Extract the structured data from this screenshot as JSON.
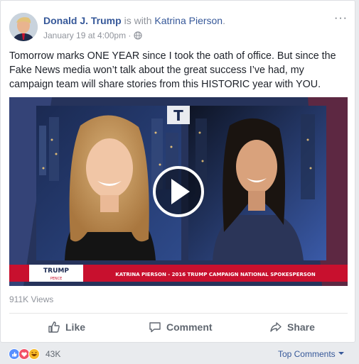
{
  "post": {
    "author": "Donald J. Trump",
    "with_text": " is with ",
    "tagged": "Katrina Pierson",
    "tag_suffix": ".",
    "timestamp": "January 19 at 4:00pm",
    "separator": " · ",
    "more": "···",
    "text": "Tomorrow marks ONE YEAR since I took the oath of office. But since the Fake News media won’t talk about the great success I’ve had, my campaign team will share stories from this HISTORIC year with YOU."
  },
  "video": {
    "lower_third_logo_top": "TRUMP",
    "lower_third_logo_bottom": "PENCE",
    "lower_third_caption": "KATRINA PIERSON - 2016 TRUMP CAMPAIGN NATIONAL SPOKESPERSON",
    "play_icon": "play-icon",
    "network_logo": "T"
  },
  "stats": {
    "views": "911K Views",
    "reactions": "43K"
  },
  "actions": {
    "like": "Like",
    "comment": "Comment",
    "share": "Share"
  },
  "comments": {
    "sort_label": "Top Comments"
  },
  "colors": {
    "link": "#365899",
    "like_blue": "#5890ff",
    "love_red": "#f25268",
    "haha_yellow": "#f7b928",
    "lower_third_red": "#c8102e"
  }
}
